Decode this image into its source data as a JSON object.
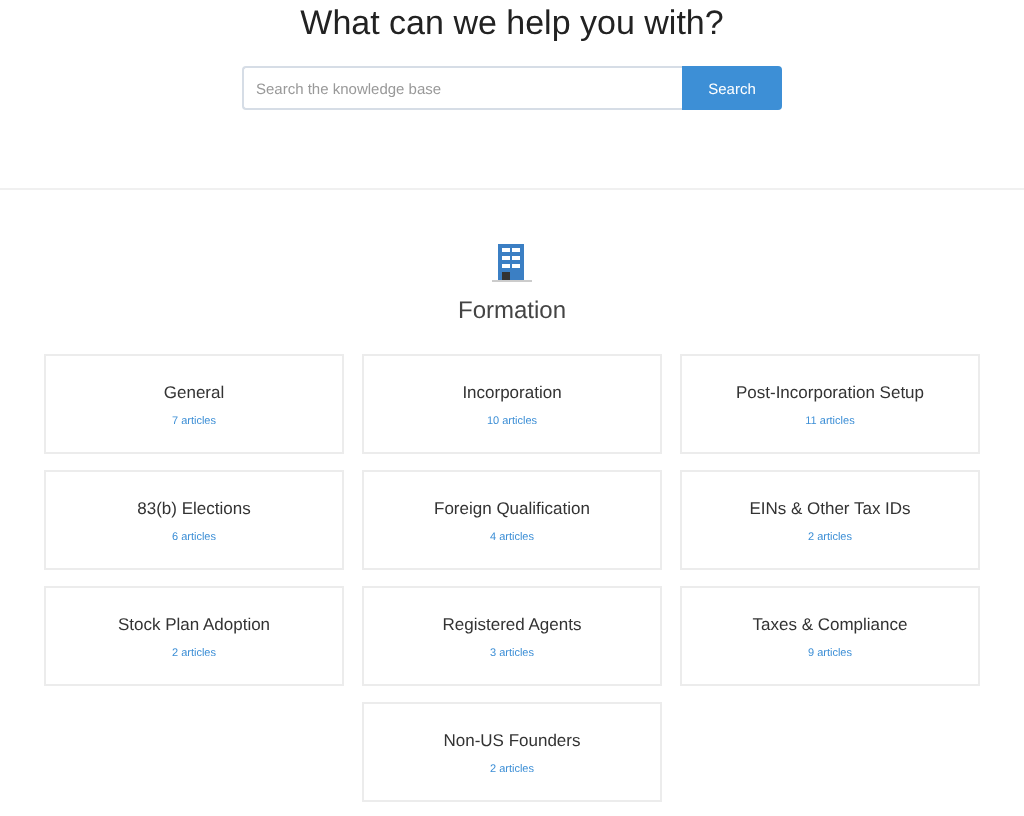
{
  "hero": {
    "title": "What can we help you with?",
    "search": {
      "placeholder": "Search the knowledge base",
      "button": "Search"
    }
  },
  "section": {
    "title": "Formation",
    "categories": [
      {
        "name": "General",
        "count": "7 articles"
      },
      {
        "name": "Incorporation",
        "count": "10 articles"
      },
      {
        "name": "Post-Incorporation Setup",
        "count": "11 articles"
      },
      {
        "name": "83(b) Elections",
        "count": "6 articles"
      },
      {
        "name": "Foreign Qualification",
        "count": "4 articles"
      },
      {
        "name": "EINs & Other Tax IDs",
        "count": "2 articles"
      },
      {
        "name": "Stock Plan Adoption",
        "count": "2 articles"
      },
      {
        "name": "Registered Agents",
        "count": "3 articles"
      },
      {
        "name": "Taxes & Compliance",
        "count": "9 articles"
      },
      {
        "name": "Non-US Founders",
        "count": "2 articles"
      }
    ]
  }
}
